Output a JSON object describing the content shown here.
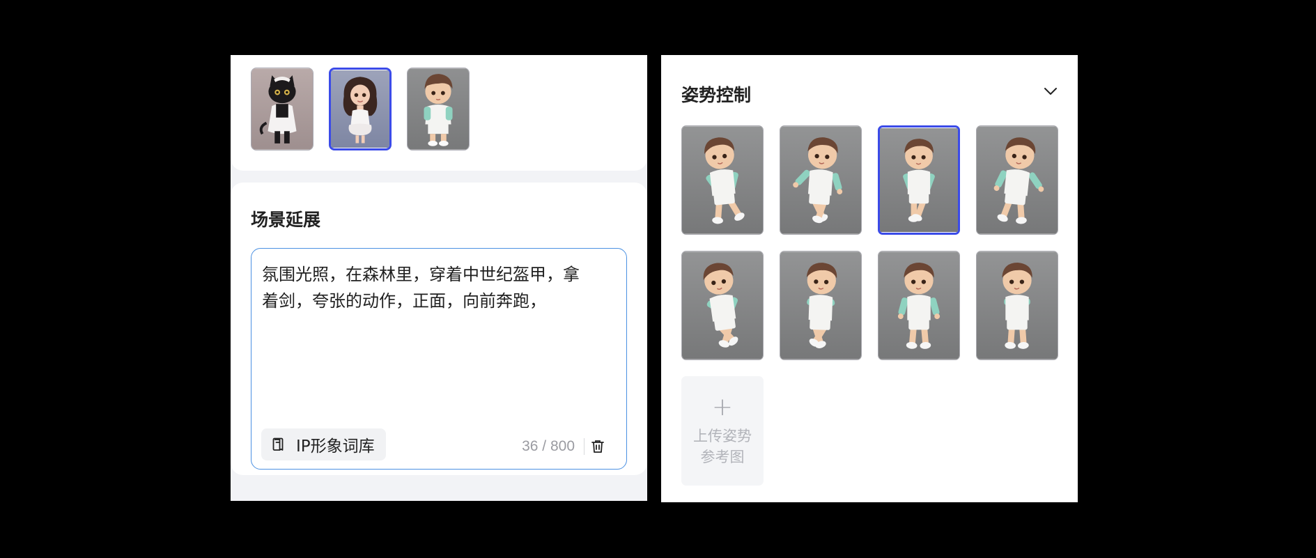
{
  "ip_thumbnails": [
    {
      "name": "black-cat-girl",
      "selected": false
    },
    {
      "name": "curly-hair-girl",
      "selected": true
    },
    {
      "name": "boy-character",
      "selected": false
    }
  ],
  "scene": {
    "title": "场景延展",
    "prompt": "氛围光照，在森林里，穿着中世纪盔甲，拿着剑，夸张的动作，正面，向前奔跑，",
    "lexicon_button": "IP形象词库",
    "counter": "36 / 800"
  },
  "pose_control": {
    "title": "姿势控制",
    "selected_index": 2,
    "poses": [
      "pose-1",
      "pose-2",
      "pose-3",
      "pose-4",
      "pose-5",
      "pose-6",
      "pose-7",
      "pose-8"
    ],
    "upload_plus": "+",
    "upload_label": "上传姿势参考图"
  },
  "colors": {
    "accent": "#3b4be8",
    "input_border": "#4a90e2"
  }
}
